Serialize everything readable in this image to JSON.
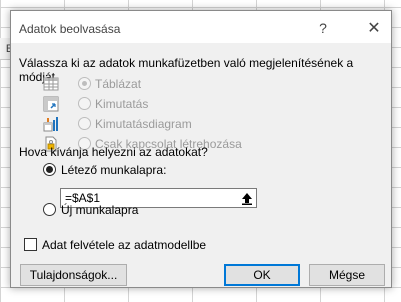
{
  "background": {
    "corner_label": "E"
  },
  "dialog": {
    "title": "Adatok beolvasása",
    "help_label": "?",
    "close_label": "✕",
    "display_prompt": "Válassza ki az adatok munkafüzetben való megjelenítésének a módját.",
    "display_options": [
      {
        "label": "Táblázat",
        "icon": "table-icon",
        "selected": true,
        "enabled": false
      },
      {
        "label": "Kimutatás",
        "icon": "pivottable-icon",
        "selected": false,
        "enabled": false
      },
      {
        "label": "Kimutatásdiagram",
        "icon": "pivotchart-icon",
        "selected": false,
        "enabled": false
      },
      {
        "label": "Csak kapcsolat létrehozása",
        "icon": "connection-only-icon",
        "selected": false,
        "enabled": false
      }
    ],
    "location_prompt": "Hova kívánja helyezni az adatokat?",
    "location_options": [
      {
        "label": "Létező munkalapra:",
        "selected": true
      },
      {
        "label": "Új munkalapra",
        "selected": false
      }
    ],
    "range_value": "=$A$1",
    "checkbox_label": "Adat felvétele az adatmodellbe",
    "checkbox_checked": false,
    "buttons": {
      "properties": "Tulajdonságok...",
      "ok": "OK",
      "cancel": "Mégse"
    },
    "colors": {
      "accent": "#0078d7",
      "dialog_bg": "#f0f0f0",
      "disabled_text": "#9b9b9b"
    }
  }
}
